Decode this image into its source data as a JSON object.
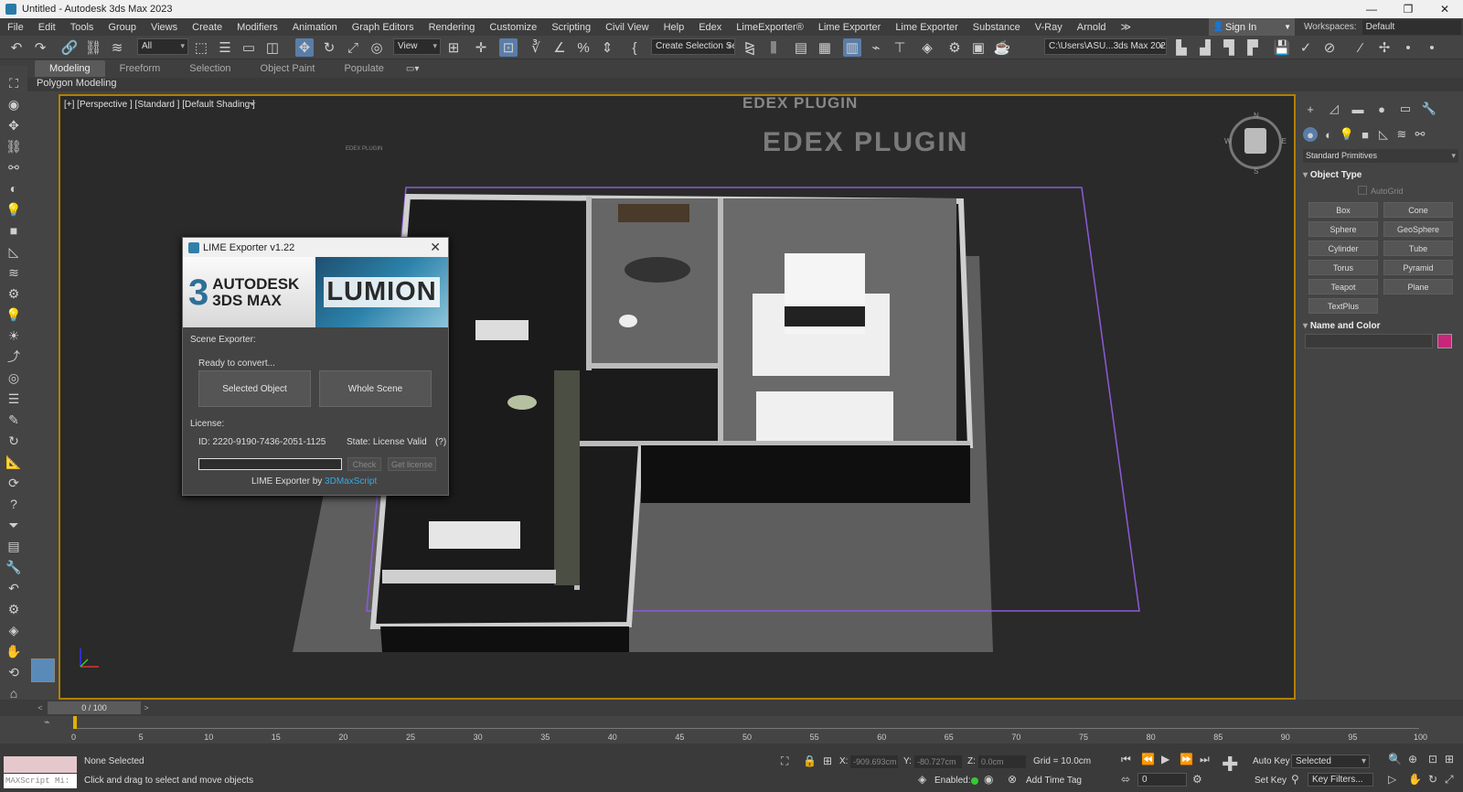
{
  "window": {
    "title": "Untitled - Autodesk 3ds Max 2023"
  },
  "menu": [
    "File",
    "Edit",
    "Tools",
    "Group",
    "Views",
    "Create",
    "Modifiers",
    "Animation",
    "Graph Editors",
    "Rendering",
    "Customize",
    "Scripting",
    "Civil View",
    "Help",
    "Edex",
    "LimeExporter®",
    "Lime Exporter",
    "Lime Exporter",
    "Substance",
    "V-Ray",
    "Arnold"
  ],
  "menu_more": "≫",
  "signin": "Sign In",
  "workspaces": {
    "label": "Workspaces:",
    "value": "Default"
  },
  "toolbar": {
    "selection_filter": "All",
    "ref_coord": "View",
    "named_selection": "Create Selection Se",
    "project_path": "C:\\Users\\ASU...3ds Max 2023"
  },
  "ribbon": {
    "tabs": [
      "Modeling",
      "Freeform",
      "Selection",
      "Object Paint",
      "Populate"
    ],
    "sub": "Polygon Modeling"
  },
  "viewport": {
    "label": "[+] [Perspective ] [Standard ] [Default Shading ]",
    "watermark_small": "EDEX PLUGIN",
    "watermark_large": "EDEX  PLUGIN",
    "tiny_label": "EDEX PLUGIN",
    "cube": {
      "n": "N",
      "w": "W",
      "e": "E",
      "s": "S"
    }
  },
  "dialog": {
    "title": "LIME Exporter v1.22",
    "banner_number": "3",
    "banner_left": [
      "AUTODESK",
      "3DS MAX"
    ],
    "banner_right": "LUMION",
    "scene_exporter": "Scene Exporter:",
    "ready": "Ready to convert...",
    "btn_selected": "Selected Object",
    "btn_whole": "Whole Scene",
    "license_label": "License:",
    "license_id": "ID: 2220-9190-7436-2051-1125",
    "license_state": "State: License Valid",
    "help": "(?)",
    "btn_check": "Check",
    "btn_get_license": "Get license",
    "footer_text": "LIME Exporter by ",
    "footer_link": "3DMaxScript"
  },
  "command_panel": {
    "category": "Standard Primitives",
    "object_type": "Object Type",
    "autogrid": "AutoGrid",
    "buttons": [
      "Box",
      "Cone",
      "Sphere",
      "GeoSphere",
      "Cylinder",
      "Tube",
      "Torus",
      "Pyramid",
      "Teapot",
      "Plane",
      "TextPlus"
    ],
    "name_and_color": "Name and Color",
    "color": "#c8267a"
  },
  "timeline": {
    "slider": "0 / 100",
    "ticks": [
      "0",
      "5",
      "10",
      "15",
      "20",
      "25",
      "30",
      "35",
      "40",
      "45",
      "50",
      "55",
      "60",
      "65",
      "70",
      "75",
      "80",
      "85",
      "90",
      "95",
      "100"
    ]
  },
  "status": {
    "maxscript": "MAXScript Mi:",
    "selection": "None Selected",
    "prompt": "Click and drag to select and move objects",
    "x_label": "X:",
    "x_val": "-909.693cm",
    "y_label": "Y:",
    "y_val": "-80.727cm",
    "z_label": "Z:",
    "z_val": "0.0cm",
    "grid": "Grid = 10.0cm",
    "enabled": "Enabled:",
    "add_time_tag": "Add Time Tag",
    "frame": "0",
    "auto_key": "Auto Key",
    "set_key": "Set Key",
    "key_mode": "Selected",
    "key_filters": "Key Filters..."
  }
}
